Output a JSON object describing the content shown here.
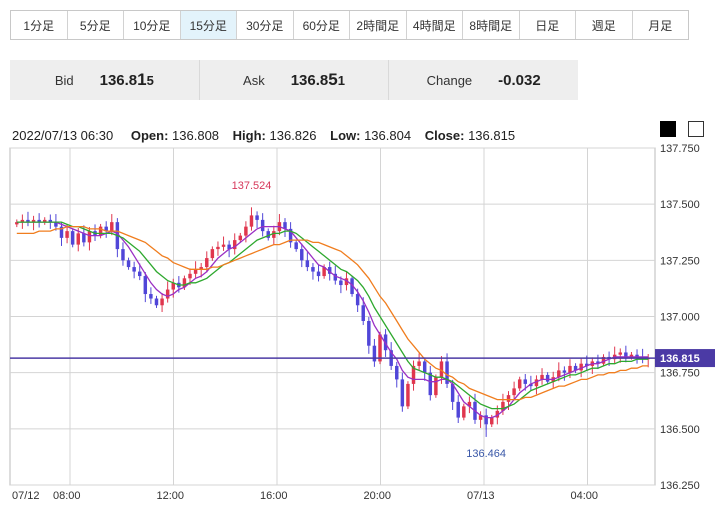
{
  "timeframes": [
    "1分足",
    "5分足",
    "10分足",
    "15分足",
    "30分足",
    "60分足",
    "2時間足",
    "4時間足",
    "8時間足",
    "日足",
    "週足",
    "月足"
  ],
  "active_timeframe": "15分足",
  "quote": {
    "bid_label": "Bid",
    "bid_main": "136.8",
    "bid_big": "1",
    "bid_small": "5",
    "ask_label": "Ask",
    "ask_main": "136.8",
    "ask_big": "5",
    "ask_small": "1",
    "change_label": "Change",
    "change_value": "-0.032"
  },
  "info": {
    "timestamp": "2022/07/13 06:30",
    "open_label": "Open:",
    "open": "136.808",
    "high_label": "High:",
    "high": "136.826",
    "low_label": "Low:",
    "low": "136.804",
    "close_label": "Close:",
    "close": "136.815"
  },
  "colors": {
    "up": "#e0364e",
    "down": "#5046d8",
    "ma_short": "#9a2fc4",
    "ma_mid": "#2ea82e",
    "ma_long": "#f07d1e",
    "current_line": "#4b3aa5"
  },
  "chart_data": {
    "type": "candlestick",
    "y_ticks": [
      "137.750",
      "137.500",
      "137.250",
      "137.000",
      "136.750",
      "136.500",
      "136.250"
    ],
    "ylim": [
      136.25,
      137.75
    ],
    "x_ticks": [
      "07/12",
      "08:00",
      "12:00",
      "16:00",
      "20:00",
      "07/13",
      "04:00"
    ],
    "current_price_label": "136.815",
    "current_price": 136.815,
    "annotations": [
      {
        "text": "137.524",
        "value": 137.524,
        "kind": "high"
      },
      {
        "text": "136.464",
        "value": 136.464,
        "kind": "low"
      }
    ],
    "closes": [
      137.42,
      137.43,
      137.42,
      137.43,
      137.42,
      137.43,
      137.42,
      137.4,
      137.35,
      137.38,
      137.32,
      137.37,
      137.33,
      137.38,
      137.36,
      137.4,
      137.38,
      137.42,
      137.3,
      137.25,
      137.22,
      137.2,
      137.18,
      137.1,
      137.08,
      137.05,
      137.08,
      137.12,
      137.15,
      137.13,
      137.17,
      137.19,
      137.21,
      137.22,
      137.26,
      137.3,
      137.31,
      137.32,
      137.3,
      137.34,
      137.36,
      137.4,
      137.45,
      137.43,
      137.38,
      137.35,
      137.38,
      137.42,
      137.39,
      137.33,
      137.3,
      137.25,
      137.22,
      137.2,
      137.18,
      137.22,
      137.19,
      137.16,
      137.14,
      137.17,
      137.1,
      137.05,
      136.98,
      136.87,
      136.8,
      136.92,
      136.85,
      136.78,
      136.72,
      136.6,
      136.7,
      136.78,
      136.8,
      136.75,
      136.65,
      136.73,
      136.8,
      136.7,
      136.62,
      136.55,
      136.6,
      136.62,
      136.54,
      136.56,
      136.52,
      136.55,
      136.58,
      136.62,
      136.65,
      136.68,
      136.72,
      136.7,
      136.69,
      136.72,
      136.74,
      136.71,
      136.73,
      136.76,
      136.75,
      136.78,
      136.76,
      136.79,
      136.78,
      136.8,
      136.79,
      136.82,
      136.81,
      136.83,
      136.84,
      136.82,
      136.83,
      136.82,
      136.81,
      136.815
    ],
    "series": [
      {
        "name": "",
        "role": "ma_short",
        "values": [
          137.42,
          137.42,
          137.42,
          137.42,
          137.42,
          137.42,
          137.42,
          137.42,
          137.41,
          137.4,
          137.39,
          137.38,
          137.37,
          137.36,
          137.36,
          137.36,
          137.37,
          137.38,
          137.37,
          137.34,
          137.31,
          137.27,
          137.23,
          137.19,
          137.15,
          137.12,
          137.1,
          137.09,
          137.1,
          137.12,
          137.13,
          137.15,
          137.17,
          137.18,
          137.2,
          137.23,
          137.26,
          137.28,
          137.3,
          137.31,
          137.33,
          137.35,
          137.37,
          137.39,
          137.4,
          137.4,
          137.4,
          137.4,
          137.39,
          137.38,
          137.35,
          137.32,
          137.29,
          137.26,
          137.23,
          137.22,
          137.2,
          137.18,
          137.17,
          137.16,
          137.14,
          137.11,
          137.07,
          137.02,
          136.96,
          136.92,
          136.88,
          136.84,
          136.81,
          136.76,
          136.73,
          136.72,
          136.72,
          136.72,
          136.71,
          136.71,
          136.72,
          136.72,
          136.7,
          136.66,
          136.62,
          136.6,
          136.58,
          136.56,
          136.55,
          136.55,
          136.56,
          136.58,
          136.6,
          136.63,
          136.66,
          136.68,
          136.7,
          136.71,
          136.72,
          136.72,
          136.72,
          136.73,
          136.74,
          136.75,
          136.76,
          136.77,
          136.78,
          136.79,
          136.79,
          136.8,
          136.81,
          136.82,
          136.82,
          136.82,
          136.82,
          136.82,
          136.82,
          136.82
        ]
      },
      {
        "name": "",
        "role": "ma_mid",
        "values": [
          137.42,
          137.42,
          137.42,
          137.42,
          137.42,
          137.42,
          137.42,
          137.42,
          137.42,
          137.41,
          137.4,
          137.4,
          137.39,
          137.38,
          137.37,
          137.37,
          137.37,
          137.37,
          137.36,
          137.35,
          137.33,
          137.31,
          137.29,
          137.26,
          137.23,
          137.2,
          137.18,
          137.16,
          137.15,
          137.14,
          137.14,
          137.15,
          137.15,
          137.16,
          137.17,
          137.19,
          137.21,
          137.23,
          137.24,
          137.26,
          137.28,
          137.3,
          137.32,
          137.34,
          137.35,
          137.36,
          137.37,
          137.37,
          137.38,
          137.38,
          137.37,
          137.35,
          137.33,
          137.31,
          137.29,
          137.27,
          137.25,
          137.23,
          137.21,
          137.2,
          137.18,
          137.16,
          137.13,
          137.09,
          137.04,
          137.0,
          136.96,
          136.92,
          136.88,
          136.84,
          136.8,
          136.77,
          136.76,
          136.75,
          136.74,
          136.73,
          136.73,
          136.72,
          136.71,
          136.69,
          136.67,
          136.65,
          136.63,
          136.61,
          136.6,
          136.59,
          136.59,
          136.59,
          136.6,
          136.61,
          136.63,
          136.65,
          136.67,
          136.68,
          136.69,
          136.7,
          136.71,
          136.72,
          136.73,
          136.74,
          136.74,
          136.75,
          136.76,
          136.77,
          136.77,
          136.78,
          136.79,
          136.79,
          136.8,
          136.8,
          136.8,
          136.81,
          136.81,
          136.81
        ]
      },
      {
        "name": "",
        "role": "ma_long",
        "values": [
          137.37,
          137.37,
          137.37,
          137.37,
          137.38,
          137.38,
          137.38,
          137.39,
          137.39,
          137.4,
          137.4,
          137.4,
          137.4,
          137.39,
          137.39,
          137.39,
          137.38,
          137.38,
          137.38,
          137.37,
          137.36,
          137.35,
          137.34,
          137.33,
          137.31,
          137.29,
          137.27,
          137.26,
          137.24,
          137.23,
          137.22,
          137.21,
          137.21,
          137.21,
          137.21,
          137.22,
          137.22,
          137.23,
          137.24,
          137.25,
          137.26,
          137.27,
          137.28,
          137.29,
          137.3,
          137.31,
          137.32,
          137.32,
          137.33,
          137.34,
          137.34,
          137.34,
          137.34,
          137.33,
          137.33,
          137.32,
          137.31,
          137.3,
          137.29,
          137.27,
          137.25,
          137.23,
          137.2,
          137.17,
          137.13,
          137.09,
          137.06,
          137.02,
          136.98,
          136.94,
          136.9,
          136.87,
          136.84,
          136.81,
          136.79,
          136.77,
          136.76,
          136.74,
          136.73,
          136.71,
          136.7,
          136.68,
          136.67,
          136.66,
          136.65,
          136.64,
          136.63,
          136.63,
          136.63,
          136.63,
          136.63,
          136.64,
          136.64,
          136.65,
          136.66,
          136.67,
          136.68,
          136.69,
          136.69,
          136.7,
          136.71,
          136.72,
          136.72,
          136.73,
          136.74,
          136.74,
          136.75,
          136.75,
          136.76,
          136.76,
          136.77,
          136.77,
          136.78,
          136.78
        ]
      }
    ]
  }
}
